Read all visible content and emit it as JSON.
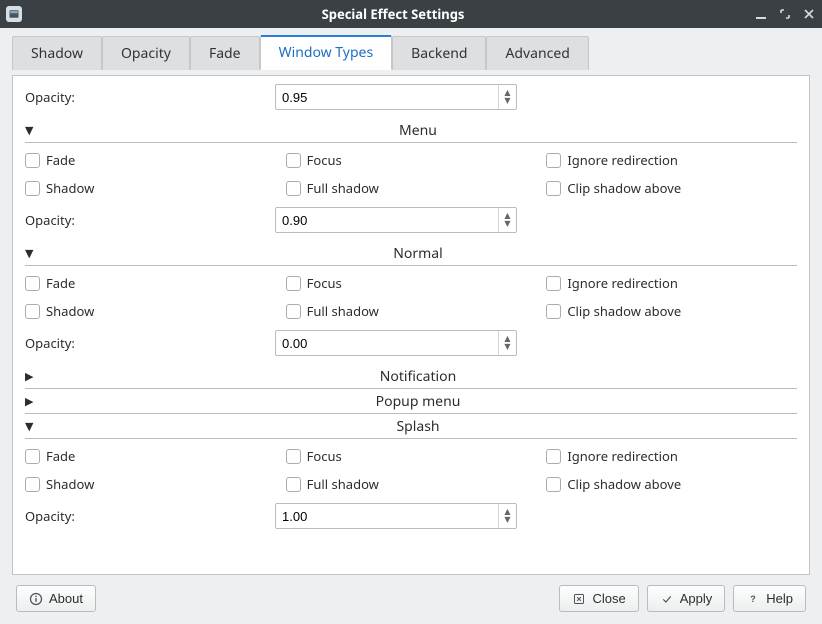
{
  "window": {
    "title": "Special Effect Settings"
  },
  "tabs": [
    {
      "label": "Shadow"
    },
    {
      "label": "Opacity"
    },
    {
      "label": "Fade"
    },
    {
      "label": "Window Types",
      "active": true
    },
    {
      "label": "Backend"
    },
    {
      "label": "Advanced"
    }
  ],
  "labels": {
    "opacity": "Opacity:",
    "fade": "Fade",
    "shadow": "Shadow",
    "focus": "Focus",
    "full_shadow": "Full shadow",
    "ignore_redirection": "Ignore redirection",
    "clip_shadow_above": "Clip shadow above"
  },
  "top_opacity": {
    "value": "0.95"
  },
  "groups": {
    "menu": {
      "title": "Menu",
      "expanded": true,
      "opacity": "0.90"
    },
    "normal": {
      "title": "Normal",
      "expanded": true,
      "opacity": "0.00"
    },
    "notification": {
      "title": "Notification",
      "expanded": false
    },
    "popup_menu": {
      "title": "Popup menu",
      "expanded": false
    },
    "splash": {
      "title": "Splash",
      "expanded": true,
      "opacity": "1.00"
    }
  },
  "footer": {
    "about": "About",
    "close": "Close",
    "apply": "Apply",
    "help": "Help"
  }
}
